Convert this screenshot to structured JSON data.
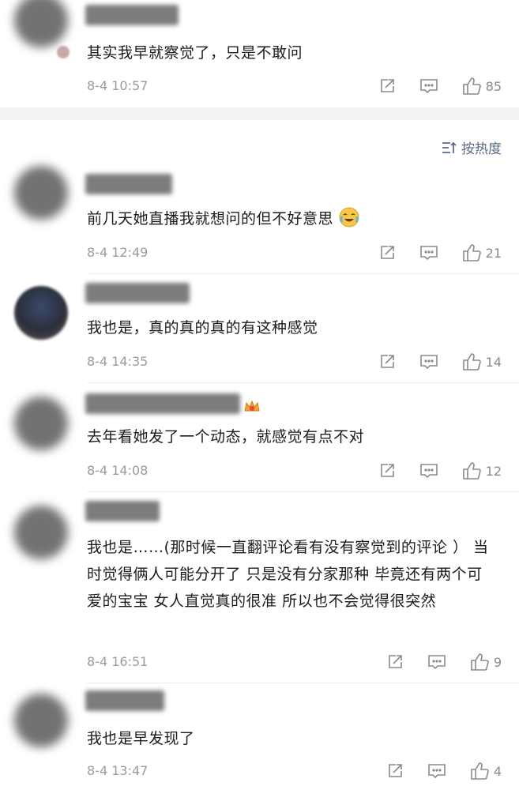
{
  "sort": {
    "label": "按热度"
  },
  "comments": [
    {
      "text": "其实我早就察觉了，只是不敢问",
      "time": "8-4 10:57",
      "likes": "85"
    },
    {
      "text": "前几天她直播我就想问的但不好意思",
      "time": "8-4 12:49",
      "likes": "21"
    },
    {
      "text": "我也是，真的真的真的有这种感觉",
      "time": "8-4 14:35",
      "likes": "14"
    },
    {
      "text": "去年看她发了一个动态，就感觉有点不对",
      "time": "8-4 14:08",
      "likes": "12"
    },
    {
      "text": "我也是……(那时候一直翻评论看有没有察觉到的评论 ） 当时觉得俩人可能分开了 只是没有分家那种  毕竟还有两个可爱的宝宝  女人直觉真的很准 所以也不会觉得很突然",
      "time": "8-4 16:51",
      "likes": "9"
    },
    {
      "text": "我也是早发现了",
      "time": "8-4 13:47",
      "likes": "4"
    }
  ],
  "icons": {
    "share": "share-icon",
    "reply": "reply-icon",
    "like": "thumbs-up-icon",
    "sort": "sort-icon",
    "emoji": "laugh-cry-emoji-icon",
    "crown": "crown-badge-icon"
  },
  "colors": {
    "accent": "#5a6b84",
    "meta": "#9b9b9b",
    "divider": "#ededed"
  }
}
